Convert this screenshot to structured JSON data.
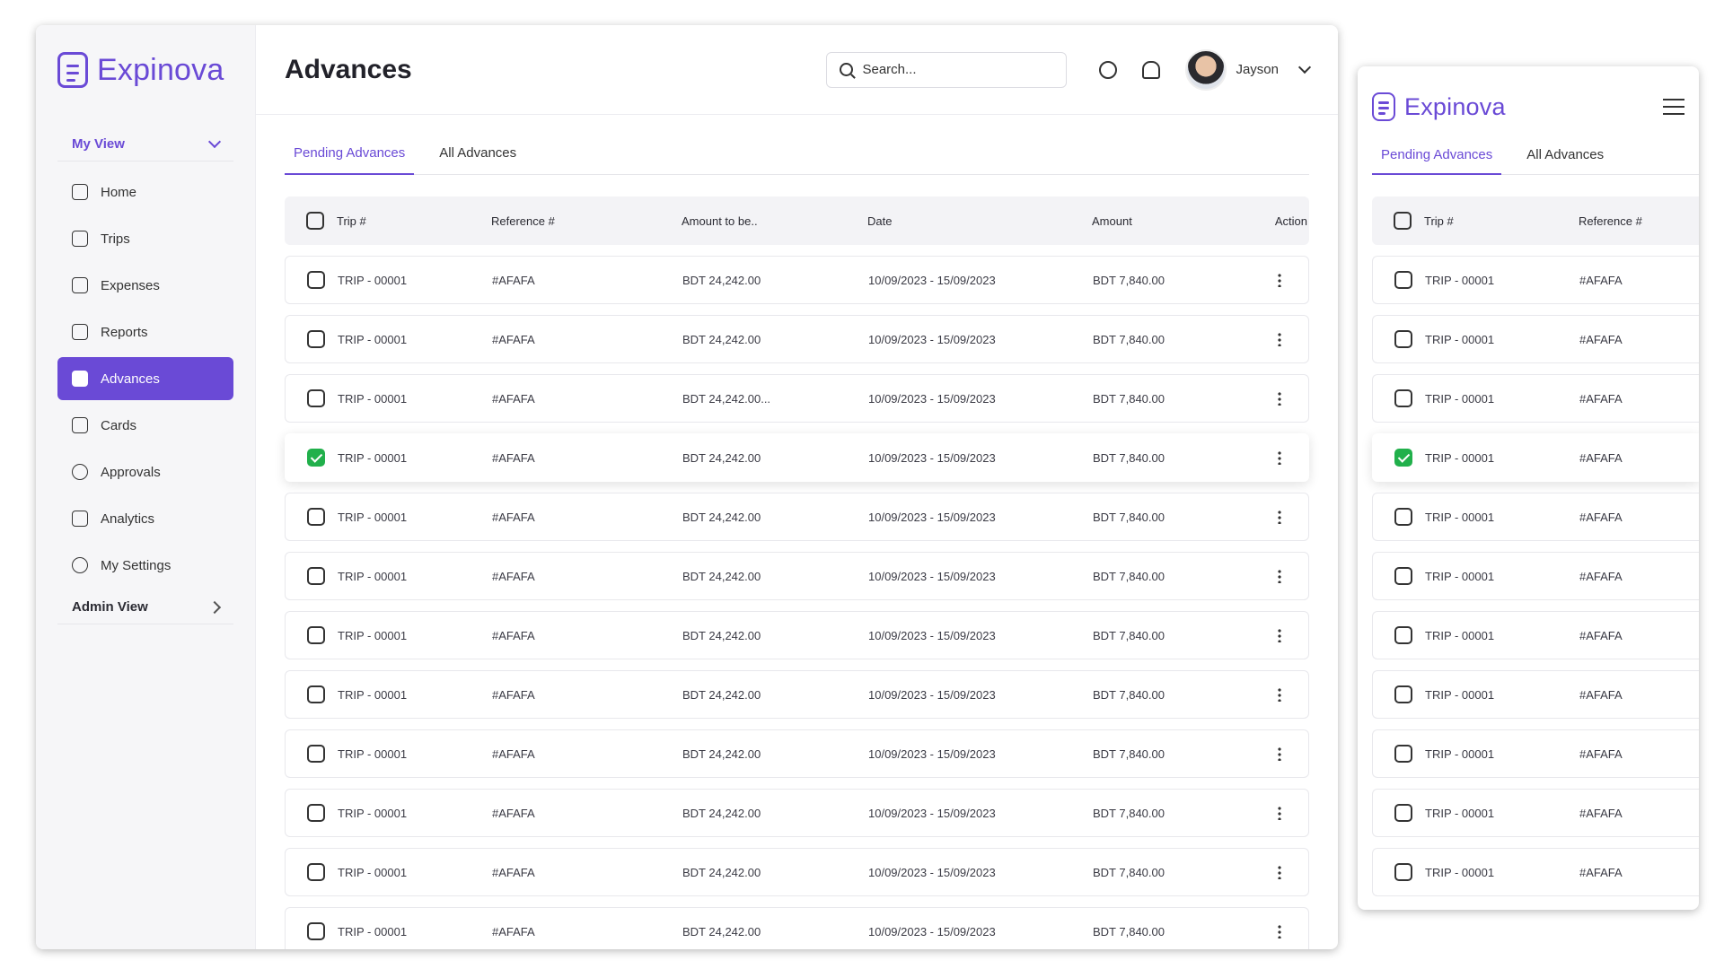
{
  "brand": {
    "name": "Expinova"
  },
  "sidebar": {
    "my_view_label": "My View",
    "admin_view_label": "Admin View",
    "items": [
      {
        "label": "Home",
        "icon": "home-icon"
      },
      {
        "label": "Trips",
        "icon": "briefcase-icon"
      },
      {
        "label": "Expenses",
        "icon": "receipt-icon"
      },
      {
        "label": "Reports",
        "icon": "folder-icon"
      },
      {
        "label": "Advances",
        "icon": "wallet-icon",
        "active": true
      },
      {
        "label": "Cards",
        "icon": "card-icon"
      },
      {
        "label": "Approvals",
        "icon": "check-circle-icon"
      },
      {
        "label": "Analytics",
        "icon": "analytics-icon"
      },
      {
        "label": "My Settings",
        "icon": "gear-icon"
      }
    ]
  },
  "header": {
    "title": "Advances",
    "search_placeholder": "Search...",
    "user_name": "Jayson"
  },
  "tabs": {
    "pending": "Pending Advances",
    "all": "All Advances"
  },
  "table": {
    "columns": {
      "trip": "Trip #",
      "reference": "Reference #",
      "amount_to_be": "Amount to be..",
      "date": "Date",
      "amount": "Amount",
      "action": "Action"
    },
    "rows": [
      {
        "trip": "TRIP - 00001",
        "reference": "#AFAFA",
        "amount_to_be": "BDT 24,242.00",
        "date": "10/09/2023 - 15/09/2023",
        "amount": "BDT 7,840.00",
        "checked": false
      },
      {
        "trip": "TRIP - 00001",
        "reference": "#AFAFA",
        "amount_to_be": "BDT 24,242.00",
        "date": "10/09/2023 - 15/09/2023",
        "amount": "BDT 7,840.00",
        "checked": false
      },
      {
        "trip": "TRIP - 00001",
        "reference": "#AFAFA",
        "amount_to_be": "BDT 24,242.00...",
        "date": "10/09/2023 - 15/09/2023",
        "amount": "BDT 7,840.00",
        "checked": false
      },
      {
        "trip": "TRIP - 00001",
        "reference": "#AFAFA",
        "amount_to_be": "BDT 24,242.00",
        "date": "10/09/2023 - 15/09/2023",
        "amount": "BDT 7,840.00",
        "checked": true
      },
      {
        "trip": "TRIP - 00001",
        "reference": "#AFAFA",
        "amount_to_be": "BDT 24,242.00",
        "date": "10/09/2023 - 15/09/2023",
        "amount": "BDT 7,840.00",
        "checked": false
      },
      {
        "trip": "TRIP - 00001",
        "reference": "#AFAFA",
        "amount_to_be": "BDT 24,242.00",
        "date": "10/09/2023 - 15/09/2023",
        "amount": "BDT 7,840.00",
        "checked": false
      },
      {
        "trip": "TRIP - 00001",
        "reference": "#AFAFA",
        "amount_to_be": "BDT 24,242.00",
        "date": "10/09/2023 - 15/09/2023",
        "amount": "BDT 7,840.00",
        "checked": false
      },
      {
        "trip": "TRIP - 00001",
        "reference": "#AFAFA",
        "amount_to_be": "BDT 24,242.00",
        "date": "10/09/2023 - 15/09/2023",
        "amount": "BDT 7,840.00",
        "checked": false
      },
      {
        "trip": "TRIP - 00001",
        "reference": "#AFAFA",
        "amount_to_be": "BDT 24,242.00",
        "date": "10/09/2023 - 15/09/2023",
        "amount": "BDT 7,840.00",
        "checked": false
      },
      {
        "trip": "TRIP - 00001",
        "reference": "#AFAFA",
        "amount_to_be": "BDT 24,242.00",
        "date": "10/09/2023 - 15/09/2023",
        "amount": "BDT 7,840.00",
        "checked": false
      },
      {
        "trip": "TRIP - 00001",
        "reference": "#AFAFA",
        "amount_to_be": "BDT 24,242.00",
        "date": "10/09/2023 - 15/09/2023",
        "amount": "BDT 7,840.00",
        "checked": false
      },
      {
        "trip": "TRIP - 00001",
        "reference": "#AFAFA",
        "amount_to_be": "BDT 24,242.00",
        "date": "10/09/2023 - 15/09/2023",
        "amount": "BDT 7,840.00",
        "checked": false
      }
    ]
  },
  "mobile": {
    "rows": [
      {
        "trip": "TRIP - 00001",
        "reference": "#AFAFA",
        "checked": false
      },
      {
        "trip": "TRIP - 00001",
        "reference": "#AFAFA",
        "checked": false
      },
      {
        "trip": "TRIP - 00001",
        "reference": "#AFAFA",
        "checked": false
      },
      {
        "trip": "TRIP - 00001",
        "reference": "#AFAFA",
        "checked": true
      },
      {
        "trip": "TRIP - 00001",
        "reference": "#AFAFA",
        "checked": false
      },
      {
        "trip": "TRIP - 00001",
        "reference": "#AFAFA",
        "checked": false
      },
      {
        "trip": "TRIP - 00001",
        "reference": "#AFAFA",
        "checked": false
      },
      {
        "trip": "TRIP - 00001",
        "reference": "#AFAFA",
        "checked": false
      },
      {
        "trip": "TRIP - 00001",
        "reference": "#AFAFA",
        "checked": false
      },
      {
        "trip": "TRIP - 00001",
        "reference": "#AFAFA",
        "checked": false
      },
      {
        "trip": "TRIP - 00001",
        "reference": "#AFAFA",
        "checked": false
      }
    ]
  },
  "colors": {
    "accent": "#6a4ad6",
    "check": "#21b04b"
  }
}
